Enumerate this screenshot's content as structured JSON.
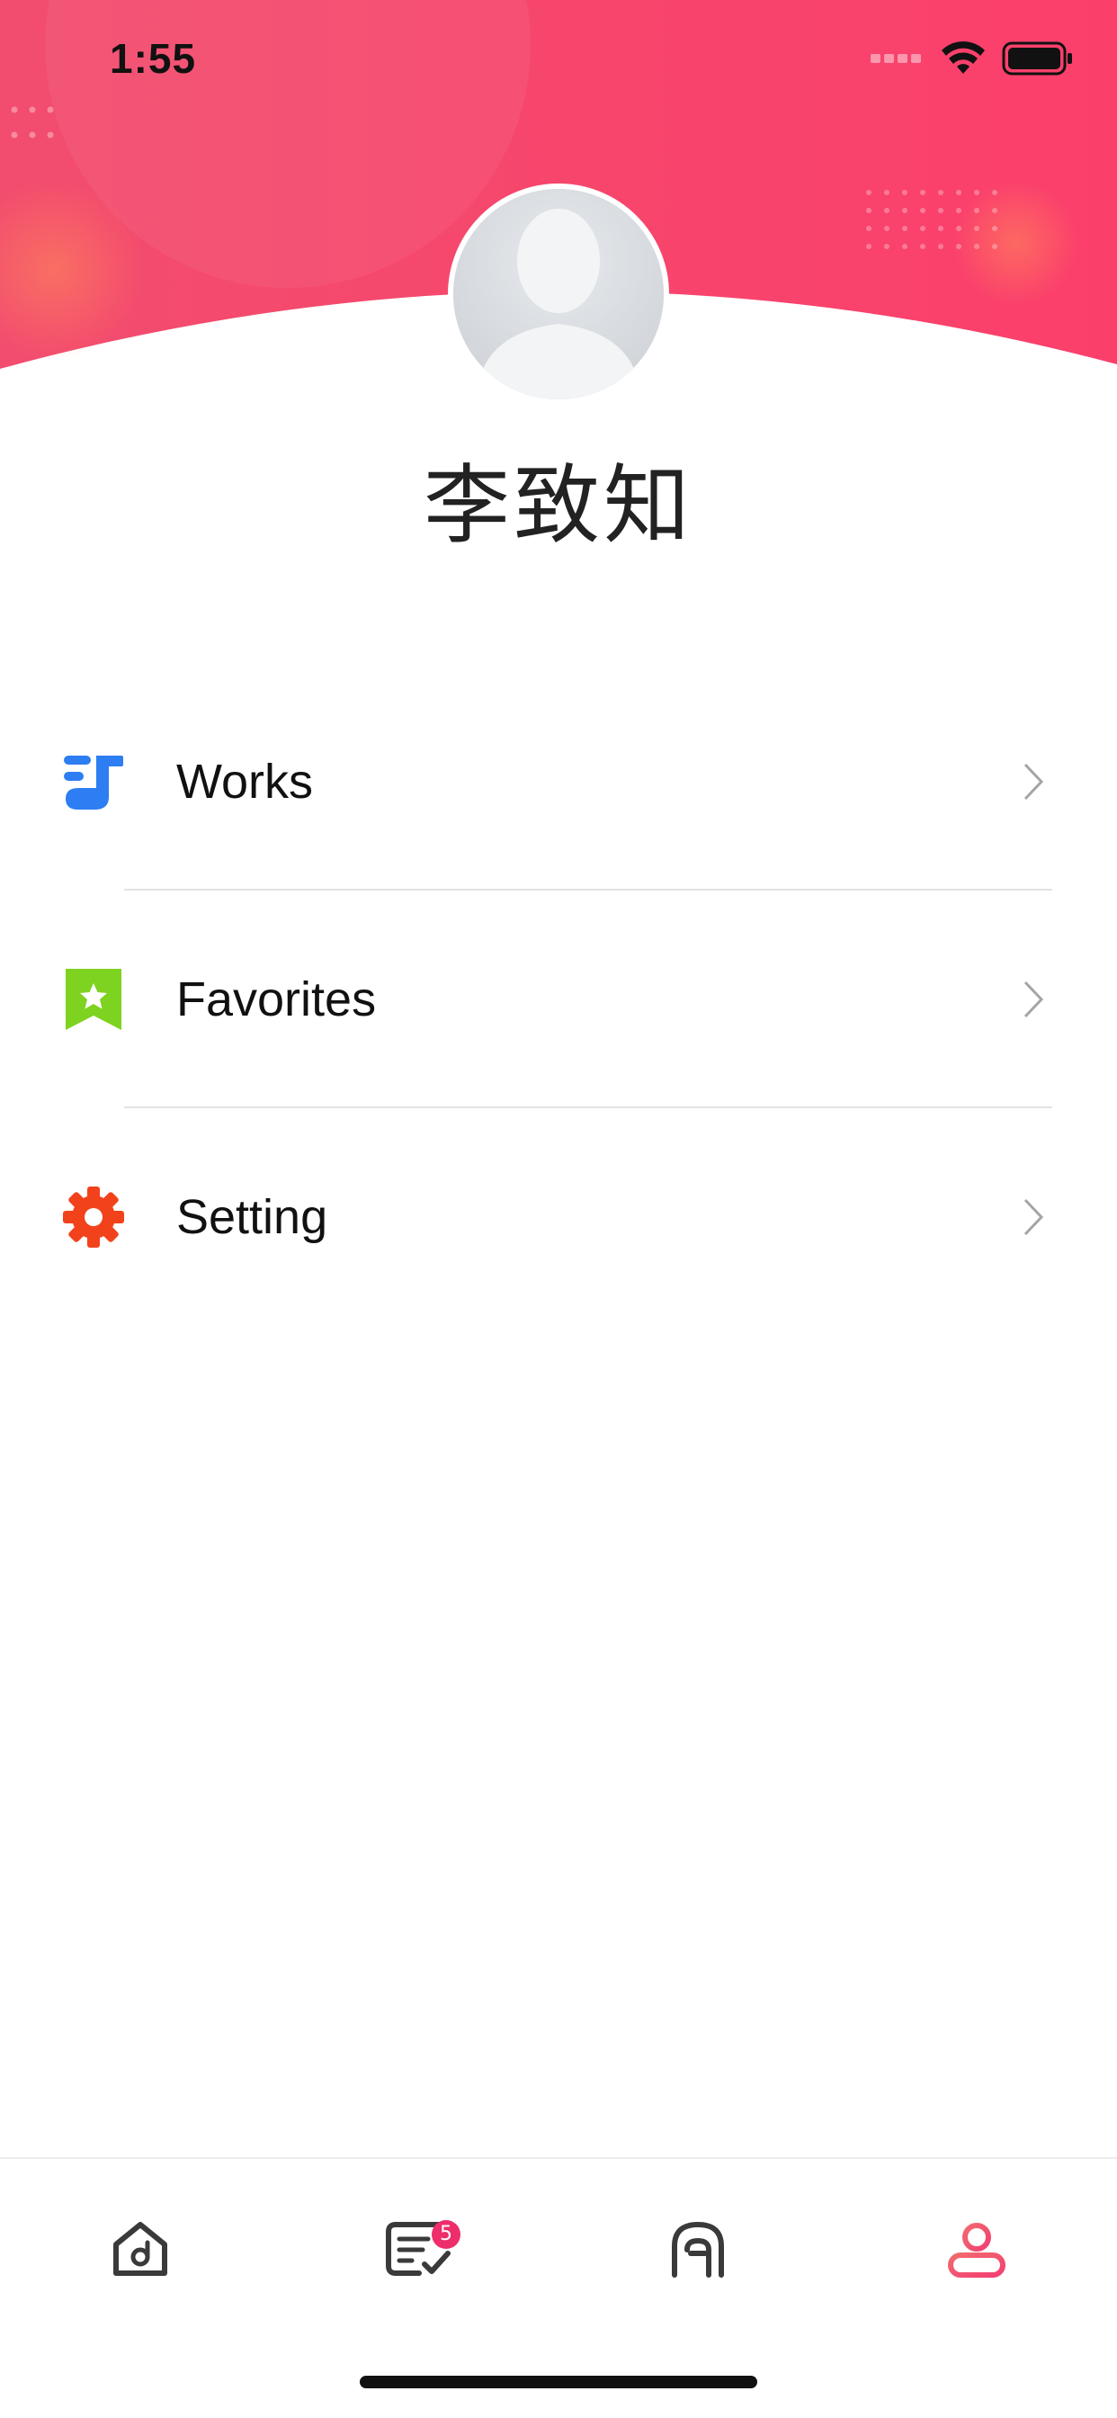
{
  "status_bar": {
    "time": "1:55",
    "icons": [
      "signal-icon",
      "wifi-icon",
      "battery-icon"
    ]
  },
  "profile": {
    "name": "李致知",
    "avatar": "default-avatar"
  },
  "menu": {
    "items": [
      {
        "label": "Works",
        "icon": "music-note-icon"
      },
      {
        "label": "Favorites",
        "icon": "bookmark-star-icon"
      },
      {
        "label": "Setting",
        "icon": "gear-icon"
      }
    ]
  },
  "tab_bar": {
    "tabs": [
      {
        "icon": "home-icon",
        "active": false
      },
      {
        "icon": "tasks-icon",
        "active": false,
        "badge": "5"
      },
      {
        "icon": "arch-icon",
        "active": false
      },
      {
        "icon": "profile-icon",
        "active": true
      }
    ]
  },
  "colors": {
    "header_start": "#f24d6e",
    "header_end": "#fb3f6b",
    "active_tab": "#f2566d",
    "inactive_tab": "#3a3a3a",
    "badge": "#ee2d6b",
    "works_icon": "#2d7df3",
    "favorites_icon": "#7ed321",
    "setting_icon": "#f2421b"
  }
}
